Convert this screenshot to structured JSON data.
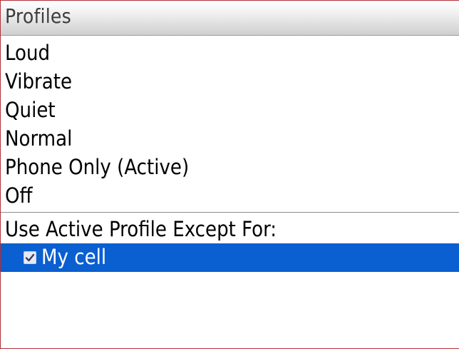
{
  "header": {
    "title": "Profiles"
  },
  "profiles": {
    "items": [
      {
        "label": "Loud"
      },
      {
        "label": "Vibrate"
      },
      {
        "label": "Quiet"
      },
      {
        "label": "Normal"
      },
      {
        "label": "Phone Only (Active)"
      },
      {
        "label": "Off"
      }
    ]
  },
  "exceptions": {
    "heading": "Use Active Profile Except For:",
    "items": [
      {
        "label": "My cell",
        "checked": true,
        "selected": true
      }
    ]
  },
  "colors": {
    "selection": "#0a5fd1",
    "frame": "#b0303a"
  }
}
